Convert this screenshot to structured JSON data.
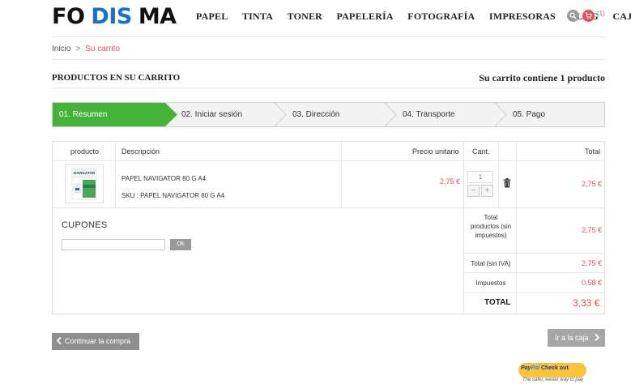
{
  "header": {
    "logo": [
      "FO",
      "DIS",
      "MA"
    ],
    "nav": [
      "PAPEL",
      "TINTA",
      "TONER",
      "PAPELERÍA",
      "FOTOGRAFÍA",
      "IMPRESORAS",
      "BLOG",
      "CAJAS"
    ],
    "cart_count": "(1)"
  },
  "breadcrumb": {
    "home": "Inicio",
    "separator": ">",
    "current": "Su carrito"
  },
  "page": {
    "title": "PRODUCTOS EN SU CARRITO",
    "summary": "Su carrito contiene 1 producto"
  },
  "steps": [
    "01. Resumen",
    "02. Iniciar sesión",
    "03. Dirección",
    "04. Transporte",
    "05. Pago"
  ],
  "table": {
    "headers": {
      "product": "producto",
      "description": "Descripción",
      "unit_price": "Precio unitario",
      "qty": "Cant.",
      "total": "Total"
    },
    "rows": [
      {
        "name": "PAPEL NAVIGATOR 80 G A4",
        "sku": "SKU : PAPEL NAVIGATOR 80 G A4",
        "unit_price": "2,75 €",
        "qty": "1",
        "total": "2,75 €",
        "image_brand": "NAVIGATOR"
      }
    ]
  },
  "coupons": {
    "title": "CUPONES",
    "ok_label": "Ok"
  },
  "totals": {
    "products_label": "Total productos (sin impuestos)",
    "products_value": "2,75 €",
    "no_vat_label": "Total (sin IVA)",
    "no_vat_value": "2,75 €",
    "taxes_label": "Impuestos",
    "taxes_value": "0,58 €",
    "total_label": "TOTAL",
    "total_value": "3,33 €"
  },
  "actions": {
    "continue": "Continuar la compra",
    "checkout": "Ir a la caja",
    "paypal_brand_a": "Pay",
    "paypal_brand_b": "Pal",
    "paypal_action": "Check out",
    "paypal_tagline": "The safer, easier way to pay"
  },
  "colors": {
    "brand_blue": "#1a6fd1",
    "accent_red": "#e05252",
    "step_active": "#45b33a",
    "button_gray": "#8f8f8f"
  }
}
